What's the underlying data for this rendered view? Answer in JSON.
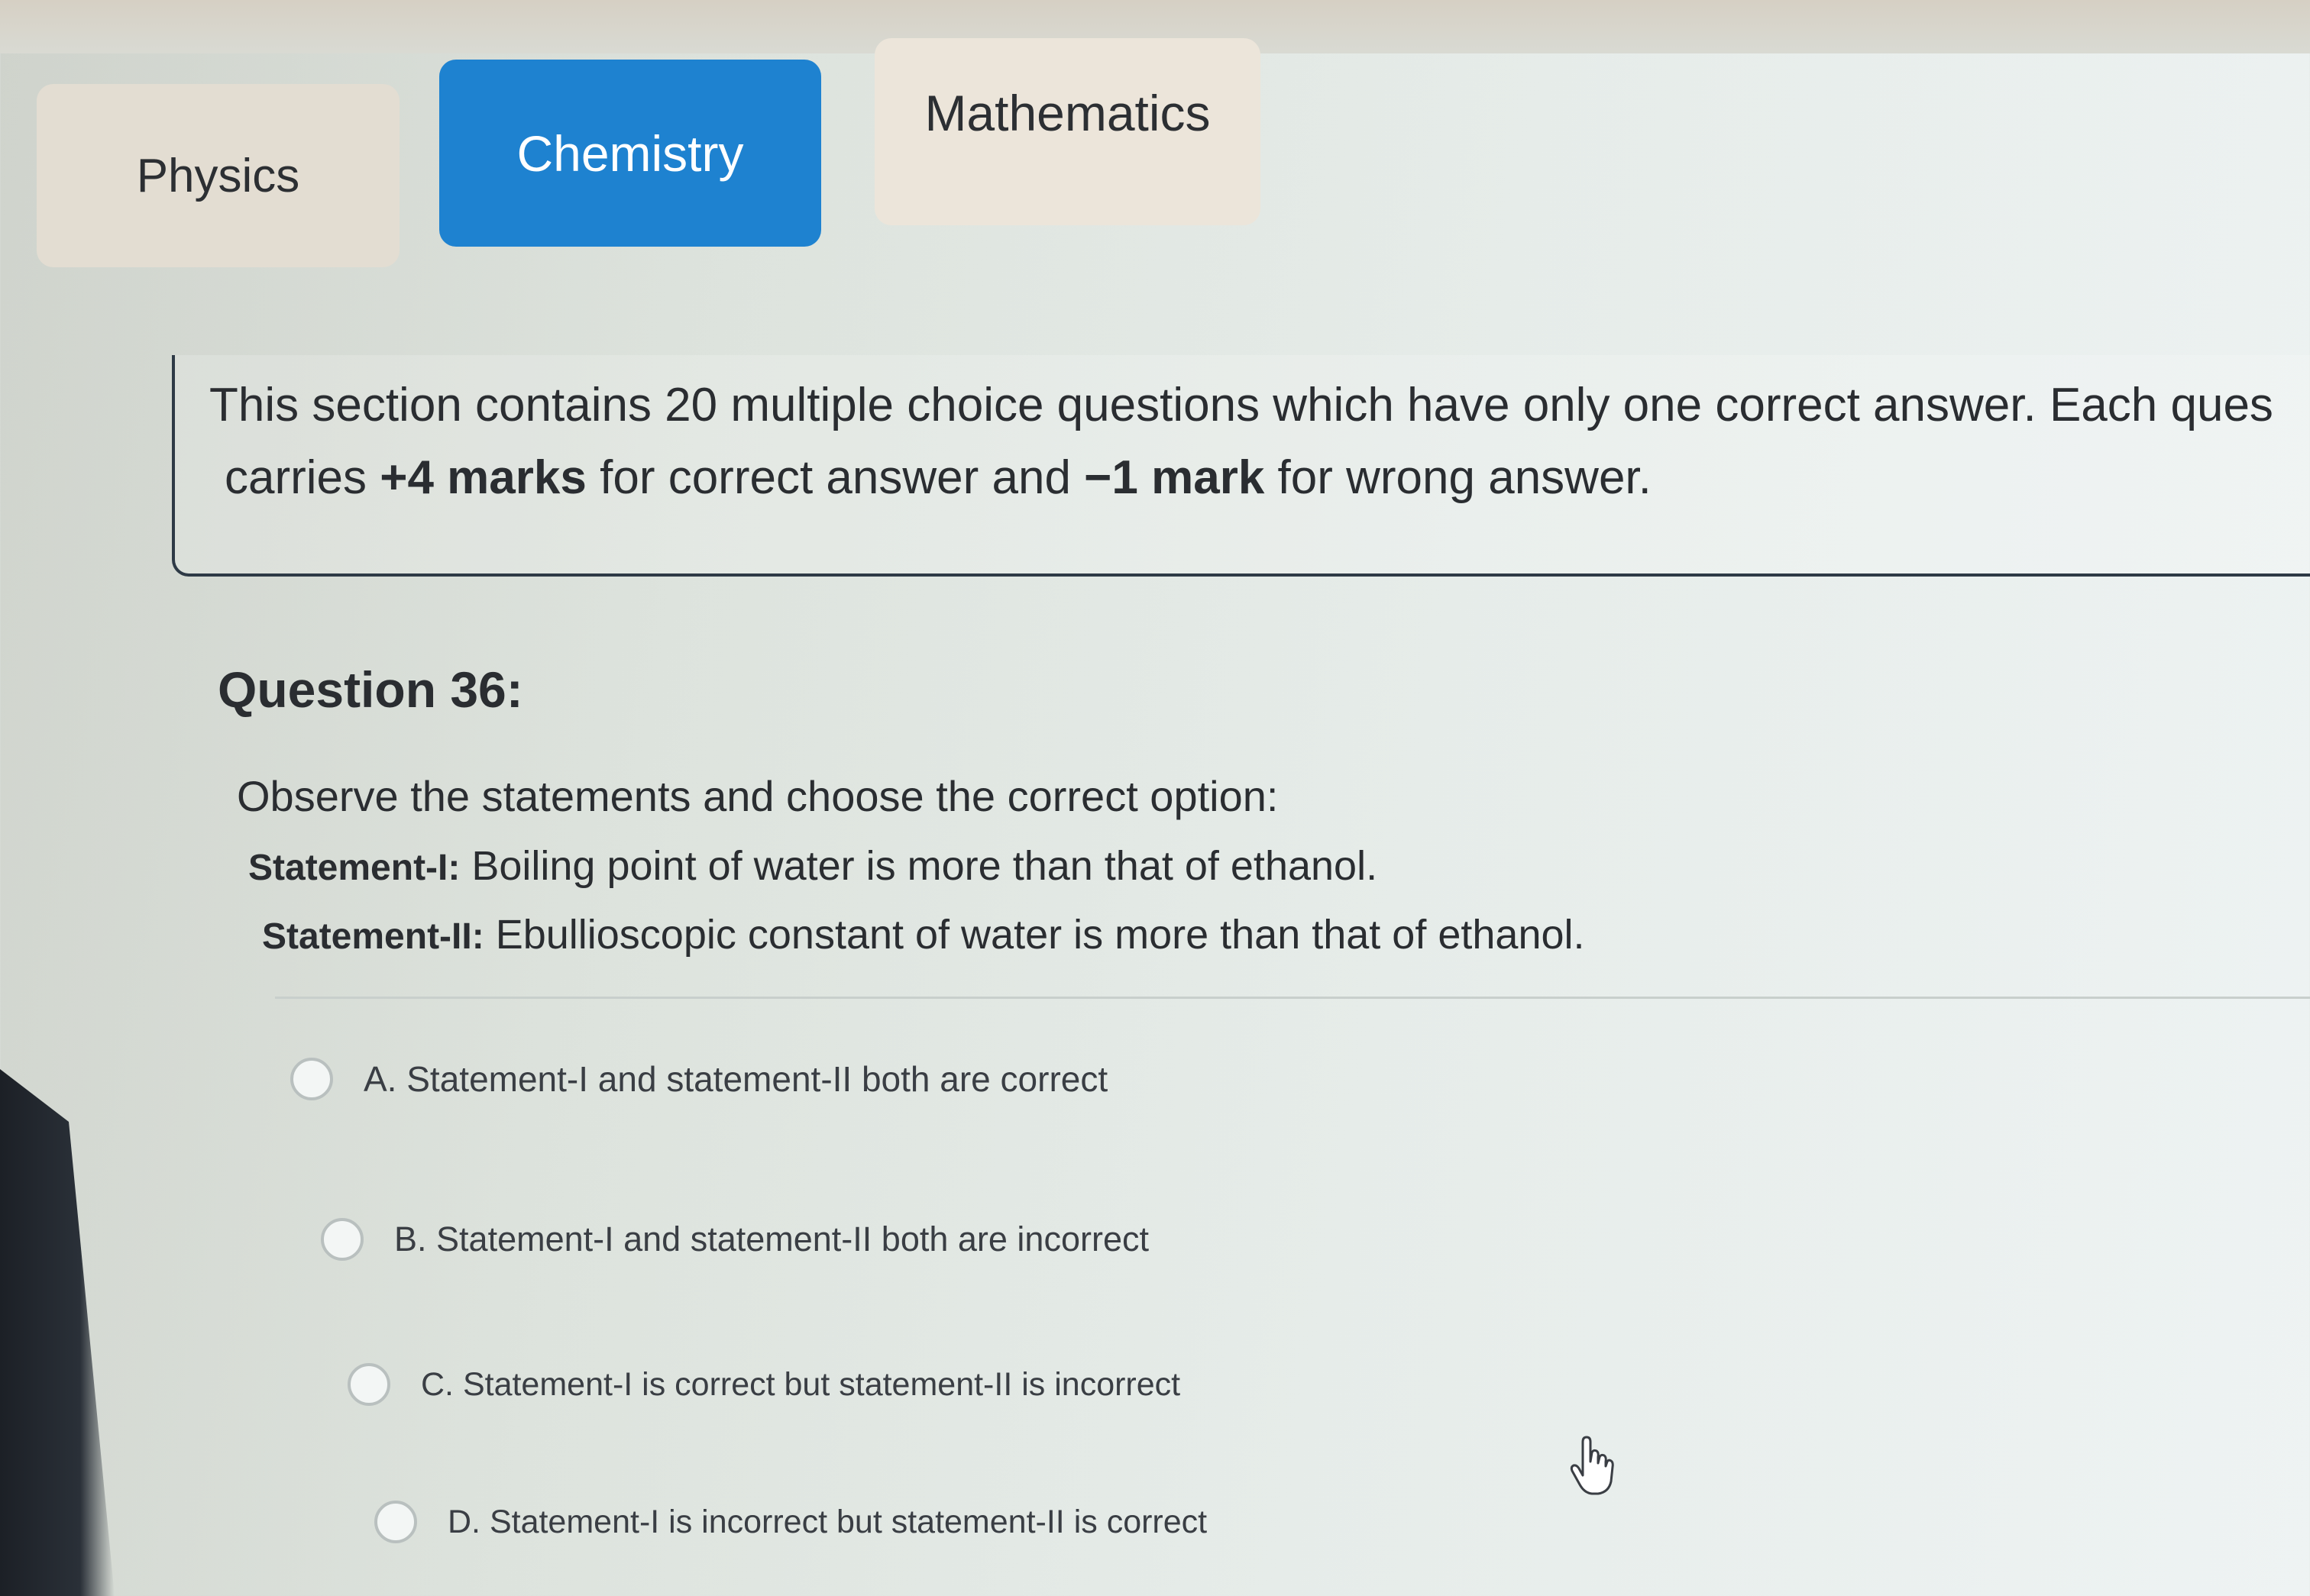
{
  "tabs": {
    "physics": "Physics",
    "chemistry": "Chemistry",
    "mathematics": "Mathematics",
    "active": "Chemistry",
    "active_color": "#1e82d0"
  },
  "instructions": {
    "line1": "This section contains 20 multiple choice questions which have only one correct answer. Each ques",
    "line2_prefix": "carries ",
    "line2_plus_marks": "+4 marks",
    "line2_middle": " for correct answer and ",
    "line2_minus_marks": "−1 mark",
    "line2_suffix": " for wrong answer."
  },
  "question": {
    "title": "Question 36:",
    "prompt": "Observe the statements and choose the correct option:",
    "statement1_label": "Statement-I:",
    "statement1_text": " Boiling point of water is more than that of ethanol.",
    "statement2_label": "Statement-II:",
    "statement2_text": " Ebullioscopic constant of water is more than that of ethanol."
  },
  "options": [
    {
      "label": "A. Statement-I and statement-II both are correct",
      "selected": false
    },
    {
      "label": "B. Statement-I and statement-II both are incorrect",
      "selected": false
    },
    {
      "label": "C. Statement-I is correct but statement-II is incorrect",
      "selected": false
    },
    {
      "label": "D. Statement-I is incorrect but statement-II is correct",
      "selected": false
    }
  ],
  "icons": {
    "cursor": "hand-pointer-icon",
    "radio": "radio-unselected-icon"
  }
}
